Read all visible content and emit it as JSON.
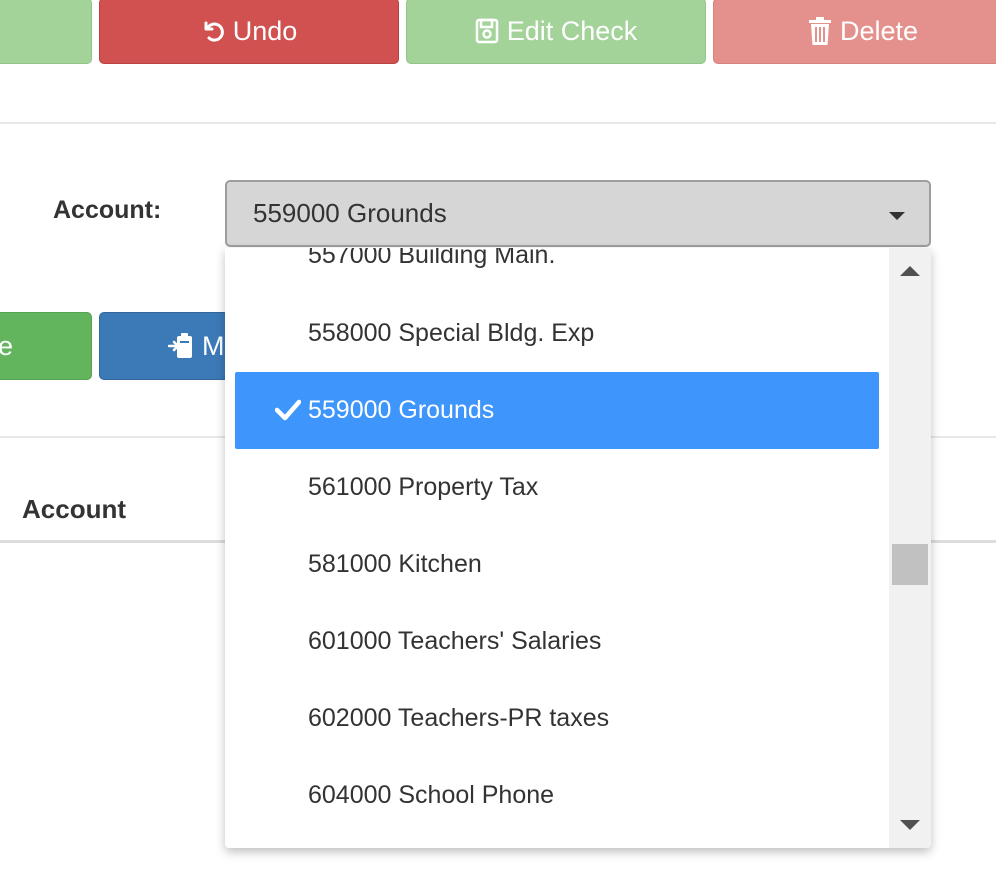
{
  "toolbar": {
    "undo_label": "Undo",
    "edit_check_label": "Edit Check",
    "delete_label": "Delete"
  },
  "form": {
    "account_label": "Account:",
    "account_selected": "559000 Grounds"
  },
  "second_row": {
    "green_button_partial": "e",
    "blue_button_partial": "M"
  },
  "table": {
    "header_account": "Account"
  },
  "dropdown": {
    "options": [
      {
        "label": "557000 Building Main.",
        "selected": false
      },
      {
        "label": "558000 Special Bldg. Exp",
        "selected": false
      },
      {
        "label": "559000 Grounds",
        "selected": true
      },
      {
        "label": "561000 Property Tax",
        "selected": false
      },
      {
        "label": "581000 Kitchen",
        "selected": false
      },
      {
        "label": "601000 Teachers' Salaries",
        "selected": false
      },
      {
        "label": "602000 Teachers-PR taxes",
        "selected": false
      },
      {
        "label": "604000 School Phone",
        "selected": false
      }
    ]
  },
  "colors": {
    "danger": "#d05150",
    "success_light": "#a4d39a",
    "danger_light": "#e4908d",
    "primary": "#3c7ab7",
    "selected_option": "#3e95fb"
  },
  "icons": {
    "undo": "undo-icon",
    "save": "save-icon",
    "delete": "trash-icon",
    "check": "check-icon",
    "clipboard": "clipboard-icon"
  }
}
